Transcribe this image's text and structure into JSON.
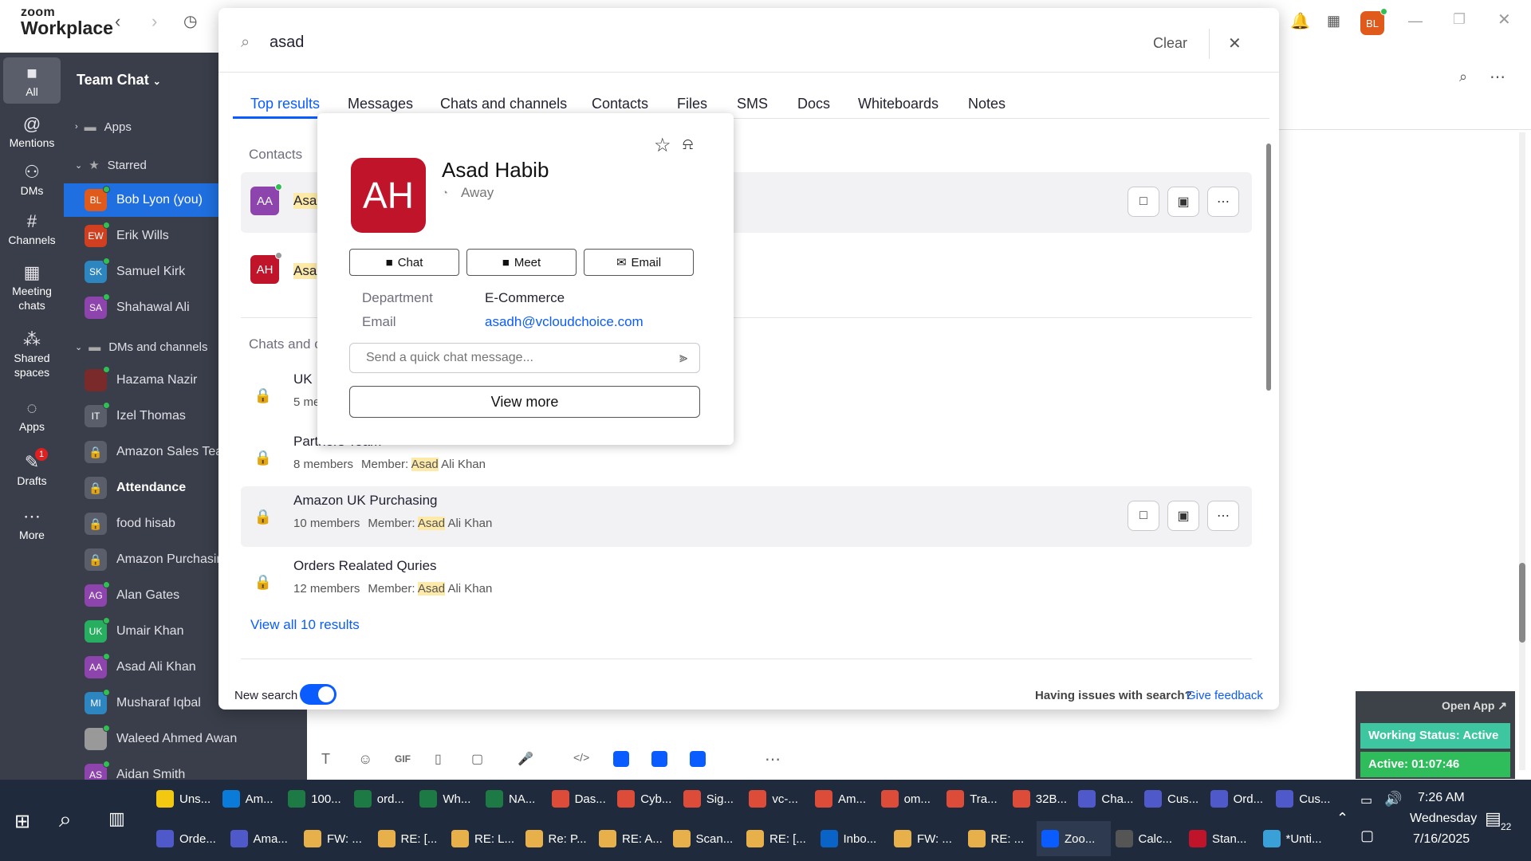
{
  "app": {
    "logo_line1": "zoom",
    "logo_line2": "Workplace",
    "avatar_initials": "BL"
  },
  "rail": [
    {
      "label": "All",
      "icon": "chat-bubble-icon"
    },
    {
      "label": "Mentions",
      "icon": "at-icon"
    },
    {
      "label": "DMs",
      "icon": "people-icon"
    },
    {
      "label": "Channels",
      "icon": "hash-icon"
    },
    {
      "label": "Meeting\nchats",
      "icon": "calendar-icon"
    },
    {
      "label": "Shared\nspaces",
      "icon": "share-icon"
    },
    {
      "label": "Apps",
      "icon": "apps-icon"
    },
    {
      "label": "Drafts",
      "icon": "drafts-icon",
      "badge": "1"
    },
    {
      "label": "More",
      "icon": "more-icon"
    }
  ],
  "sidebar": {
    "title": "Team Chat",
    "apps": "Apps",
    "starred": "Starred",
    "dms_channels": "DMs and channels",
    "starred_items": [
      {
        "initials": "BL",
        "name": "Bob Lyon (you)",
        "color": "#e05a1c"
      },
      {
        "initials": "EW",
        "name": "Erik Wills",
        "color": "#d04020"
      },
      {
        "initials": "SK",
        "name": "Samuel Kirk",
        "color": "#2e86c1"
      },
      {
        "initials": "SA",
        "name": "Shahawal Ali",
        "color": "#8e44ad"
      }
    ],
    "dm_items": [
      {
        "initials": "",
        "name": "Hazama Nazir",
        "color": "#7a2a2a"
      },
      {
        "initials": "IT",
        "name": "Izel Thomas",
        "color": "#5a5e6a"
      },
      {
        "initials": "",
        "name": "Amazon Sales Team",
        "color": "lock"
      },
      {
        "initials": "",
        "name": "Attendance",
        "color": "lock",
        "bold": true
      },
      {
        "initials": "",
        "name": "food hisab",
        "color": "lock"
      },
      {
        "initials": "",
        "name": "Amazon Purchasing",
        "color": "lock"
      },
      {
        "initials": "AG",
        "name": "Alan Gates",
        "color": "#8e44ad"
      },
      {
        "initials": "UK",
        "name": "Umair Khan",
        "color": "#27ae60"
      },
      {
        "initials": "AA",
        "name": "Asad Ali Khan",
        "color": "#8e44ad"
      },
      {
        "initials": "MI",
        "name": "Musharaf Iqbal",
        "color": "#2e86c1"
      },
      {
        "initials": "",
        "name": "Waleed Ahmed Awan",
        "color": "#999"
      },
      {
        "initials": "AS",
        "name": "Aidan Smith",
        "color": "#8e44ad"
      }
    ]
  },
  "search": {
    "query": "asad",
    "clear": "Clear"
  },
  "tabs": [
    "Top results",
    "Messages",
    "Chats and channels",
    "Contacts",
    "Files",
    "SMS",
    "Docs",
    "Whiteboards",
    "Notes"
  ],
  "contacts_header": "Contacts",
  "contacts": [
    {
      "initials": "AA",
      "name": "Asad",
      "color": "#8e44ad"
    },
    {
      "initials": "AH",
      "name": "Asa",
      "color": "#c0142b"
    }
  ],
  "chats_header": "Chats and c",
  "channels": [
    {
      "name": "UK",
      "members": "5 me",
      "member_prefix": "",
      "member_hl": "",
      "member_rest": ""
    },
    {
      "name": "Partners Team",
      "members": "8 members",
      "member_prefix": "Member: ",
      "member_hl": "Asad",
      "member_rest": " Ali Khan"
    },
    {
      "name": "Amazon UK Purchasing",
      "members": "10 members",
      "member_prefix": "Member: ",
      "member_hl": "Asad",
      "member_rest": " Ali Khan"
    },
    {
      "name": "Orders Realated Quries",
      "members": "12 members",
      "member_prefix": "Member: ",
      "member_hl": "Asad",
      "member_rest": " Ali Khan"
    }
  ],
  "view_all": "View all 10 results",
  "new_search": "New search",
  "issues": "Having issues with search?",
  "feedback": "Give feedback",
  "popup": {
    "initials": "AH",
    "name": "Asad Habib",
    "status": "Away",
    "chat": "Chat",
    "meet": "Meet",
    "email": "Email",
    "dept_label": "Department",
    "dept": "E-Commerce",
    "email_label": "Email",
    "email_value": "asadh@vcloudchoice.com",
    "placeholder": "Send a quick chat message...",
    "view_more": "View more"
  },
  "widget": {
    "open_app": "Open App ↗",
    "status": "Working Status: Active",
    "active": "Active: 01:07:46"
  },
  "taskbar": {
    "row1": [
      {
        "label": "Uns...",
        "color": "#f2c811"
      },
      {
        "label": "Am...",
        "color": "#0a7bd8"
      },
      {
        "label": "100...",
        "color": "#1d7a44"
      },
      {
        "label": "ord...",
        "color": "#1d7a44"
      },
      {
        "label": "Wh...",
        "color": "#1d7a44"
      },
      {
        "label": "NA...",
        "color": "#1d7a44"
      },
      {
        "label": "Das...",
        "color": "#dd4b39"
      },
      {
        "label": "Cyb...",
        "color": "#dd4b39"
      },
      {
        "label": "Sig...",
        "color": "#dd4b39"
      },
      {
        "label": "vc-...",
        "color": "#dd4b39"
      },
      {
        "label": "Am...",
        "color": "#dd4b39"
      },
      {
        "label": "om...",
        "color": "#dd4b39"
      },
      {
        "label": "Tra...",
        "color": "#dd4b39"
      },
      {
        "label": "32B...",
        "color": "#dd4b39"
      },
      {
        "label": "Cha...",
        "color": "#5059c9"
      },
      {
        "label": "Cus...",
        "color": "#5059c9"
      },
      {
        "label": "Ord...",
        "color": "#5059c9"
      },
      {
        "label": "Cus...",
        "color": "#5059c9"
      }
    ],
    "row2": [
      {
        "label": "Orde...",
        "color": "#5059c9"
      },
      {
        "label": "Ama...",
        "color": "#5059c9"
      },
      {
        "label": "FW: ...",
        "color": "#e8b04a"
      },
      {
        "label": "RE: [...",
        "color": "#e8b04a"
      },
      {
        "label": "RE: L...",
        "color": "#e8b04a"
      },
      {
        "label": "Re: P...",
        "color": "#e8b04a"
      },
      {
        "label": "RE: A...",
        "color": "#e8b04a"
      },
      {
        "label": "Scan...",
        "color": "#e8b04a"
      },
      {
        "label": "RE: [...",
        "color": "#e8b04a"
      },
      {
        "label": "Inbo...",
        "color": "#0a64c8"
      },
      {
        "label": "FW: ...",
        "color": "#e8b04a"
      },
      {
        "label": "RE: ...",
        "color": "#e8b04a"
      },
      {
        "label": "Zoo...",
        "color": "#0b5cff"
      },
      {
        "label": "Calc...",
        "color": "#555"
      },
      {
        "label": "Stan...",
        "color": "#c0142b"
      },
      {
        "label": "*Unti...",
        "color": "#3aa0d8"
      }
    ],
    "time": "7:26 AM",
    "day": "Wednesday",
    "date": "7/16/2025",
    "notif": "22"
  }
}
